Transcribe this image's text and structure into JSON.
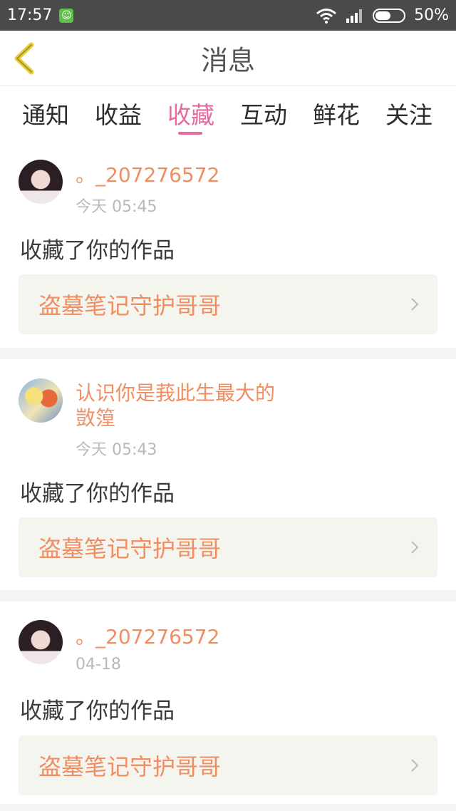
{
  "statusbar": {
    "time": "17:57",
    "battery": "50%"
  },
  "header": {
    "title": "消息"
  },
  "tabs": [
    {
      "label": "通知"
    },
    {
      "label": "收益"
    },
    {
      "label": "收藏",
      "active": true
    },
    {
      "label": "互动"
    },
    {
      "label": "鲜花"
    },
    {
      "label": "关注"
    }
  ],
  "messages": [
    {
      "user": "。_207276572",
      "time": "今天 05:45",
      "action": "收藏了你的作品",
      "work": "盗墓笔记守护哥哥"
    },
    {
      "user_line1": "认识你是莪此生最大的",
      "user_line2": "敳篞",
      "time": "今天 05:43",
      "action": "收藏了你的作品",
      "work": "盗墓笔记守护哥哥"
    },
    {
      "user": "。_207276572",
      "time": "04-18",
      "action": "收藏了你的作品",
      "work": "盗墓笔记守护哥哥"
    }
  ],
  "colors": {
    "accent": "#e56aa0",
    "name": "#f08e62"
  }
}
